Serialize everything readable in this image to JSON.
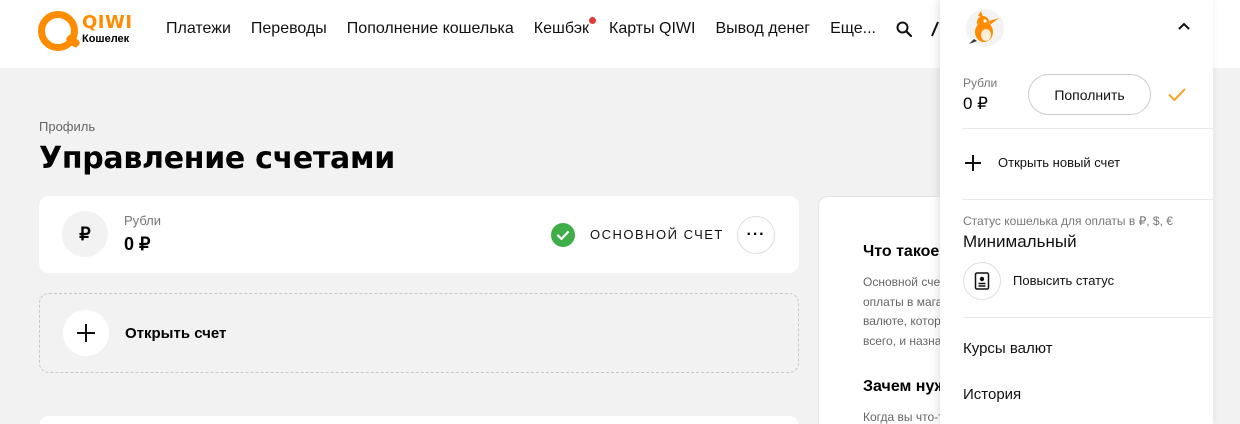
{
  "header": {
    "logo_text": "QIWI",
    "logo_sub": "Кошелек",
    "nav": [
      "Платежи",
      "Переводы",
      "Пополнение кошелька",
      "Кешбэк",
      "Карты QIWI",
      "Вывод денег",
      "Еще..."
    ],
    "accent": "#ff8c00"
  },
  "main": {
    "breadcrumb": "Профиль",
    "title": "Управление счетами",
    "account": {
      "currency_symbol": "₽",
      "label": "Рубли",
      "amount": "0 ₽",
      "main_label": "ОСНОВНОЙ СЧЕТ",
      "more": "···"
    },
    "open_account": "Открыть счет"
  },
  "info": {
    "heading1": "Что такое основной счет?",
    "paragraph": [
      "Основной счет используется для",
      "оплаты в магазинах и переводов в",
      "валюте, которая не указана, и",
      "всего, и назначить основной счет"
    ],
    "heading2": "Зачем нужен основной счет?",
    "paragraph2": "Когда вы что-то оплачиваете"
  },
  "dropdown": {
    "rub_label": "Рубли",
    "rub_amount": "0 ₽",
    "topup": "Пополнить",
    "open_new": "Открыть новый счет",
    "status_label": "Статус кошелька для оплаты в ₽, $, €",
    "status_value": "Минимальный",
    "upgrade": "Повысить статус",
    "menu": [
      "Курсы валют",
      "История"
    ]
  },
  "colors": {
    "success": "#3fae49",
    "check": "#f5a623",
    "notification_dot": "#e53935"
  }
}
